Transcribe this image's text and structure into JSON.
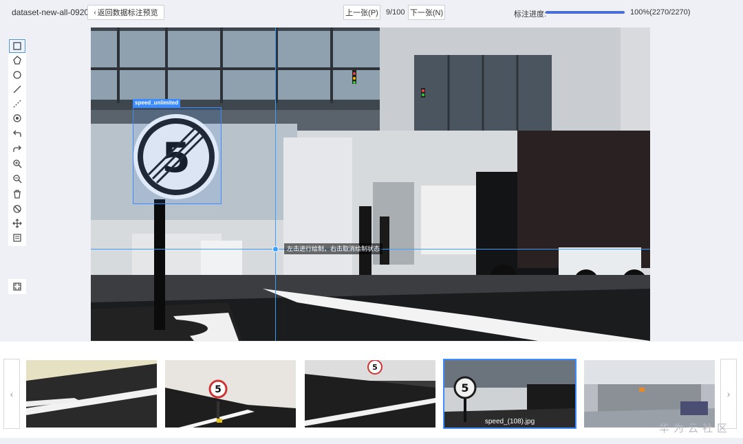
{
  "header": {
    "dataset_name": "dataset-new-all-0920",
    "back_label": "返回数据标注预览",
    "prev_label": "上一张(P)",
    "page_indicator": "9/100",
    "next_label": "下一张(N)",
    "progress_label": "标注进度:",
    "progress_fraction": 1.0,
    "progress_text": "100%(2270/2270)"
  },
  "toolbar": {
    "tools": [
      "rectangle-icon",
      "polygon-icon",
      "circle-icon",
      "line-icon",
      "dashed-line-icon",
      "point-icon",
      "undo-icon",
      "redo-icon",
      "zoom-in-icon",
      "zoom-out-icon",
      "delete-icon",
      "hide-icon",
      "move-icon",
      "label-list-icon"
    ],
    "fit_icon": "fit-screen-icon"
  },
  "canvas": {
    "bbox_label": "speed_unlimited",
    "hint_text": "左击进行绘制，右击取消绘制状态"
  },
  "filmstrip": {
    "prev_arrow": "‹",
    "next_arrow": "›",
    "selected_label": "speed_(108).jpg"
  },
  "watermark": "华为云社区",
  "colors": {
    "accent": "#3d8cff",
    "progress": "#4a6fd6"
  }
}
